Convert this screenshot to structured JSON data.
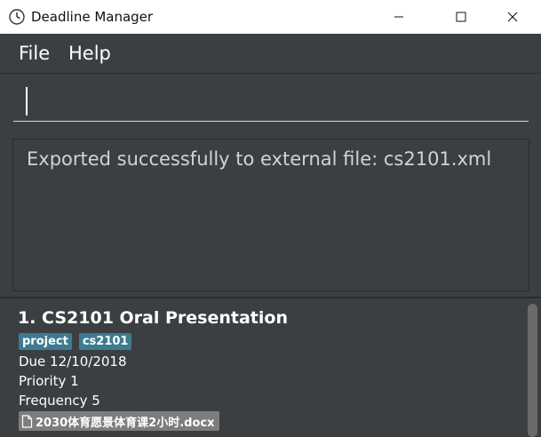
{
  "window": {
    "title": "Deadline Manager"
  },
  "menu": {
    "file_label": "File",
    "help_label": "Help"
  },
  "command": {
    "value": ""
  },
  "result": {
    "message": "Exported successfully to external file: cs2101.xml"
  },
  "tasks": [
    {
      "title": "1.  CS2101 Oral Presentation",
      "tags": [
        "project",
        "cs2101"
      ],
      "due": "Due 12/10/2018",
      "priority": "Priority 1",
      "frequency": "Frequency 5",
      "attachment": "2030体育愿景体育课2小时.docx"
    }
  ],
  "colors": {
    "background": "#3c3f41",
    "tag": "#3e7b91",
    "attachment": "#7d7d7d"
  },
  "icons": {
    "app": "clock-icon",
    "minimize": "minimize-icon",
    "maximize": "maximize-icon",
    "close": "close-icon",
    "attachment": "file-icon"
  }
}
